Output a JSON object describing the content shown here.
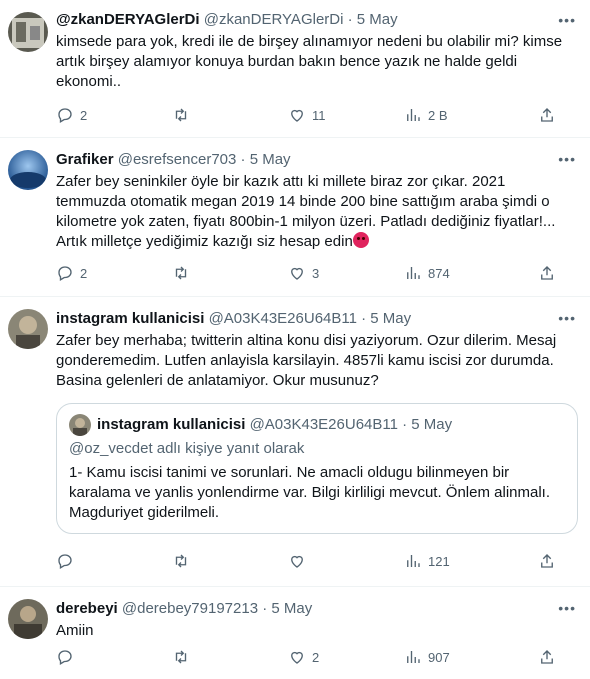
{
  "tweets": [
    {
      "name": "@zkanDERYAGlerDi",
      "handle": "@zkanDERYAGlerDi",
      "dot": "·",
      "time": "5 May",
      "text": "kimsede para yok, kredi ile de birşey alınamıyor nedeni bu olabilir mi? kimse artık birşey alamıyor konuya burdan bakın bence yazık ne halde geldi ekonomi..",
      "replies": "2",
      "retweets": "",
      "likes": "11",
      "views": "2 B"
    },
    {
      "name": "Grafiker",
      "handle": "@esrefsencer703",
      "dot": "·",
      "time": "5 May",
      "text": "Zafer bey seninkiler öyle bir kazık attı ki millete biraz zor çıkar. 2021 temmuzda otomatik megan 2019 14 binde 200 bine sattığım araba şimdi o kilometre yok zaten, fiyatı 800bin-1 milyon üzeri. Patladı dediğiniz fiyatlar!... Artık milletçe yediğimiz kazığı siz hesap edin",
      "replies": "2",
      "retweets": "",
      "likes": "3",
      "views": "874"
    },
    {
      "name": "instagram kullanicisi",
      "handle": "@A03K43E26U64B11",
      "dot": "·",
      "time": "5 May",
      "text": "Zafer bey merhaba; twitterin altina konu disi yaziyorum. Ozur dilerim. Mesaj gonderemedim. Lutfen anlayisla karsilayin. 4857li kamu iscisi zor durumda. Basina gelenleri de anlatamiyor. Okur musunuz?",
      "quote": {
        "name": "instagram kullanicisi",
        "handle": "@A03K43E26U64B11",
        "dot": "·",
        "time": "5 May",
        "reply_to": "@oz_vecdet adlı kişiye yanıt olarak",
        "text": "1- Kamu iscisi tanimi ve sorunlari.  Ne amacli oldugu bilinmeyen bir karalama ve yanlis yonlendirme var.  Bilgi kirliligi mevcut. Önlem alinmalı. Magduriyet giderilmeli."
      },
      "replies": "",
      "retweets": "",
      "likes": "",
      "views": "121"
    },
    {
      "name": "derebeyi",
      "handle": "@derebey79197213",
      "dot": "·",
      "time": "5 May",
      "text": "Amiin",
      "replies": "",
      "retweets": "",
      "likes": "2",
      "views": "907"
    }
  ],
  "icons": {
    "more": "more-icon",
    "reply": "reply-icon",
    "retweet": "retweet-icon",
    "like": "heart-icon",
    "views": "views-icon",
    "share": "share-icon"
  },
  "colors": {
    "text": "#0f1419",
    "secondary": "#536471",
    "border": "#eff3f4",
    "quote_border": "#cfd9de"
  }
}
